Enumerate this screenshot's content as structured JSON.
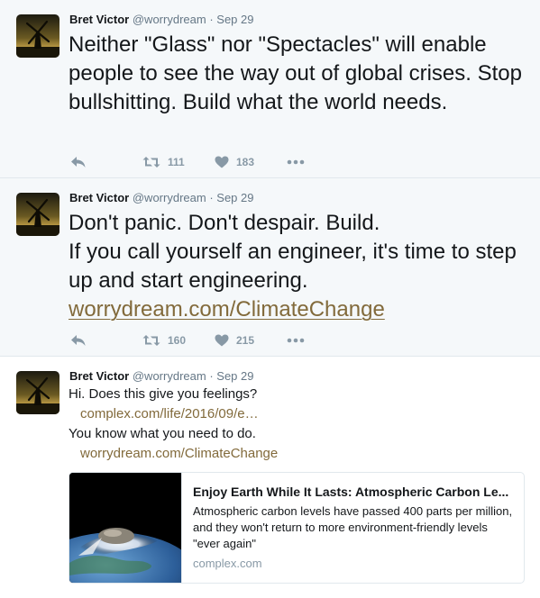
{
  "author": {
    "name": "Bret Victor",
    "handle": "@worrydream",
    "separator": "·"
  },
  "tweets": [
    {
      "date": "Sep 29",
      "text": "Neither \"Glass\" nor \"Spectacles\" will enable people to see the way out of global crises. Stop bullshitting. Build what the world needs.",
      "retweets": "111",
      "likes": "183"
    },
    {
      "date": "Sep 29",
      "line1": "Don't panic. Don't despair. Build.",
      "line2": "If you call yourself an engineer, it's time to step up and start engineering.",
      "link": "worrydream.com/ClimateChange",
      "retweets": "160",
      "likes": "215"
    },
    {
      "date": "Sep 29",
      "line1": "Hi. Does this give you feelings?",
      "link1": "complex.com/life/2016/09/e…",
      "line2": "You know what you need to do.",
      "link2": "worrydream.com/ClimateChange",
      "card": {
        "title": "Enjoy Earth While It Lasts: Atmospheric Carbon Le...",
        "description": "Atmospheric carbon levels have passed 400 parts per million, and they won't return to more environment-friendly levels \"ever again\"",
        "domain": "complex.com"
      }
    }
  ],
  "icons": {
    "reply": "reply-icon",
    "retweet": "retweet-icon",
    "like": "heart-icon",
    "more": "more-dots-icon"
  },
  "colors": {
    "link": "#826a3b",
    "muted": "#657786",
    "action": "#8899a6",
    "alt_background": "#f5f8fa"
  }
}
